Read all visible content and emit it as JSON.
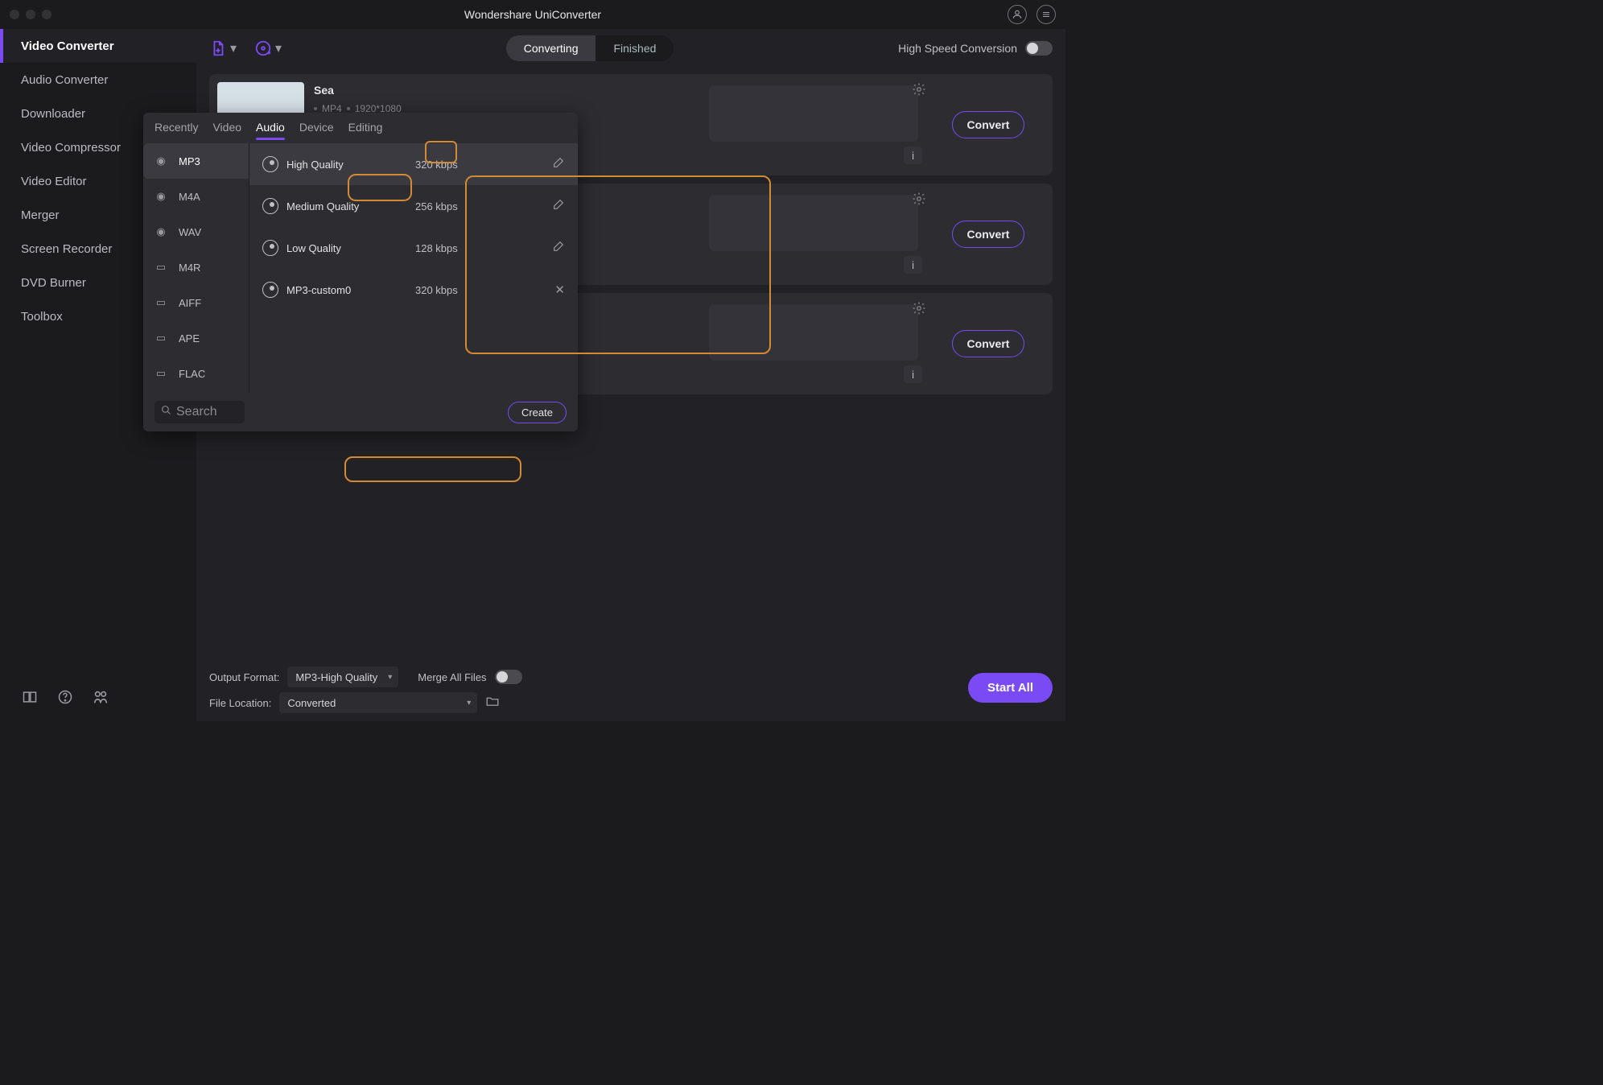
{
  "titlebar": {
    "title": "Wondershare UniConverter"
  },
  "sidebar": {
    "items": [
      {
        "label": "Video Converter",
        "active": true
      },
      {
        "label": "Audio Converter"
      },
      {
        "label": "Downloader"
      },
      {
        "label": "Video Compressor"
      },
      {
        "label": "Video Editor"
      },
      {
        "label": "Merger"
      },
      {
        "label": "Screen Recorder"
      },
      {
        "label": "DVD Burner"
      },
      {
        "label": "Toolbox"
      }
    ]
  },
  "toolbar": {
    "tabs": {
      "converting": "Converting",
      "finished": "Finished"
    },
    "hs_label": "High Speed Conversion"
  },
  "files": [
    {
      "title": "Sea",
      "fmt": "MP4",
      "res": "1920*1080",
      "convert": "Convert",
      "info": "i"
    }
  ],
  "extra_convert": "Convert",
  "extra_info": "i",
  "popup": {
    "tabs": [
      "Recently",
      "Video",
      "Audio",
      "Device",
      "Editing"
    ],
    "formats": [
      "MP3",
      "M4A",
      "WAV",
      "M4R",
      "AIFF",
      "APE",
      "FLAC"
    ],
    "qualities": [
      {
        "name": "High Quality",
        "rate": "320 kbps",
        "editable": true
      },
      {
        "name": "Medium Quality",
        "rate": "256 kbps",
        "editable": true
      },
      {
        "name": "Low Quality",
        "rate": "128 kbps",
        "editable": true
      },
      {
        "name": "MP3-custom0",
        "rate": "320 kbps",
        "editable": false
      }
    ],
    "search": "Search",
    "create": "Create"
  },
  "bottom": {
    "out_label": "Output Format:",
    "out_value": "MP3-High Quality",
    "merge_label": "Merge All Files",
    "loc_label": "File Location:",
    "loc_value": "Converted",
    "start": "Start All"
  }
}
